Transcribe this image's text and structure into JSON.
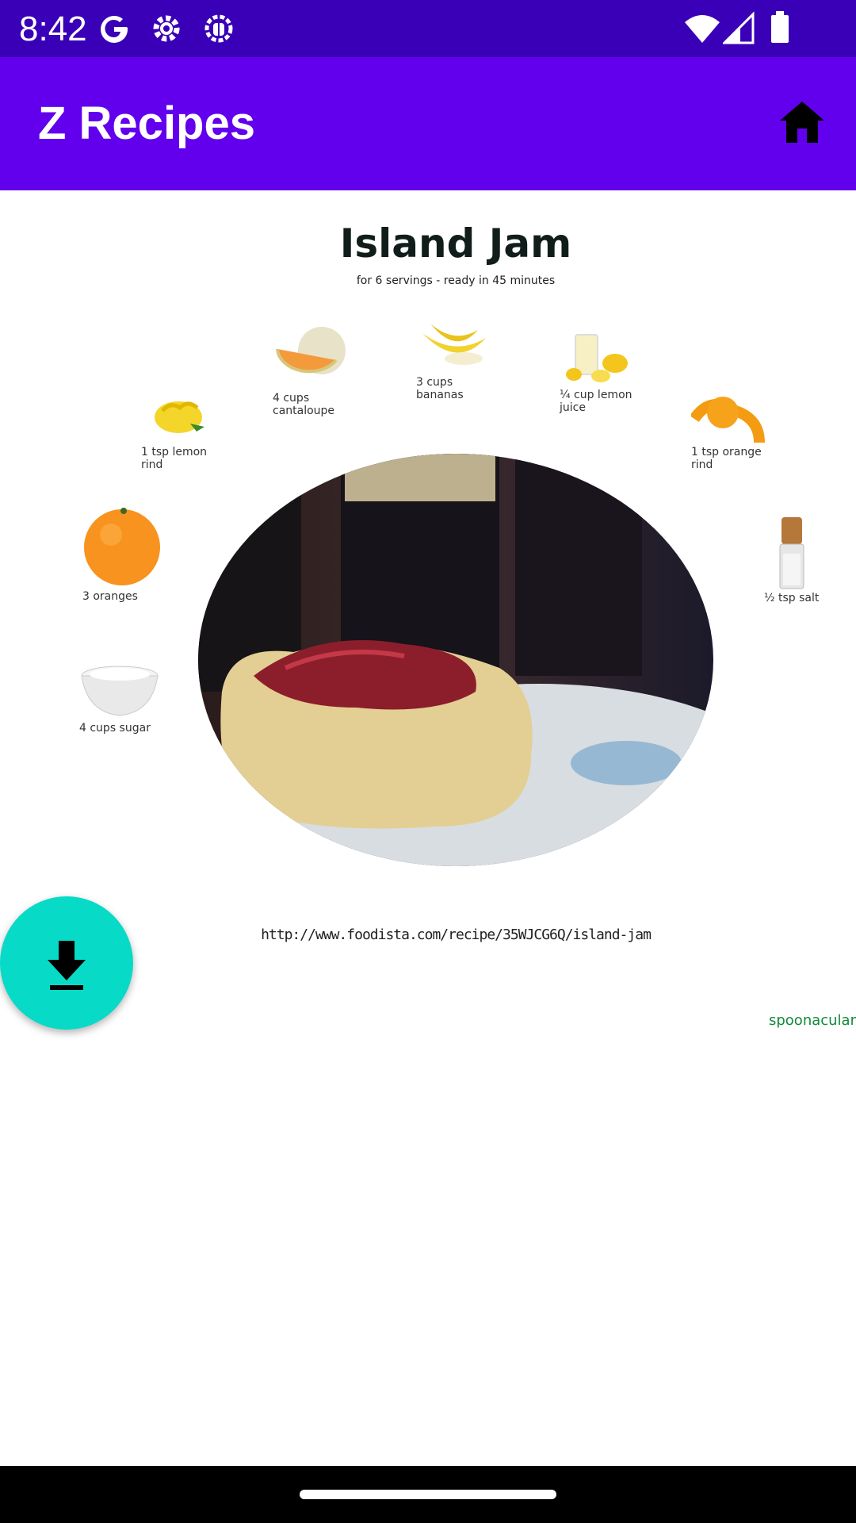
{
  "status_bar": {
    "time": "8:42",
    "icons": [
      "google-icon",
      "settings-gear-icon",
      "bug-icon",
      "wifi-icon",
      "cell-signal-icon",
      "battery-icon"
    ]
  },
  "app_bar": {
    "title": "Z Recipes",
    "home_icon": "home-icon",
    "background": "#6200ee"
  },
  "recipe": {
    "title": "Island Jam",
    "subtitle": "for 6 servings - ready in 45 minutes",
    "ingredients": [
      {
        "line1": "1 tsp lemon",
        "line2": "rind",
        "icon": "lemon-rind-icon"
      },
      {
        "line1": "4 cups",
        "line2": "cantaloupe",
        "icon": "cantaloupe-icon"
      },
      {
        "line1": "3 cups",
        "line2": "bananas",
        "icon": "bananas-icon"
      },
      {
        "line1": "¼ cup lemon",
        "line2": "juice",
        "icon": "lemon-juice-icon"
      },
      {
        "line1": "1 tsp orange",
        "line2": "rind",
        "icon": "orange-rind-icon"
      },
      {
        "line1": "3  oranges",
        "line2": "",
        "icon": "orange-icon"
      },
      {
        "line1": "½ tsp salt",
        "line2": "",
        "icon": "salt-shaker-icon"
      },
      {
        "line1": "4 cups sugar",
        "line2": "",
        "icon": "sugar-bowl-icon"
      }
    ],
    "source_url": "http://www.foodista.com/recipe/35WJCG6Q/island-jam",
    "brand": "spoonacular"
  },
  "fab": {
    "icon": "download-icon",
    "color": "#07dac6"
  },
  "colors": {
    "status_bar": "#3a00b8",
    "app_bar": "#6200ee",
    "brand": "#128a3a",
    "fab": "#07dac6"
  }
}
